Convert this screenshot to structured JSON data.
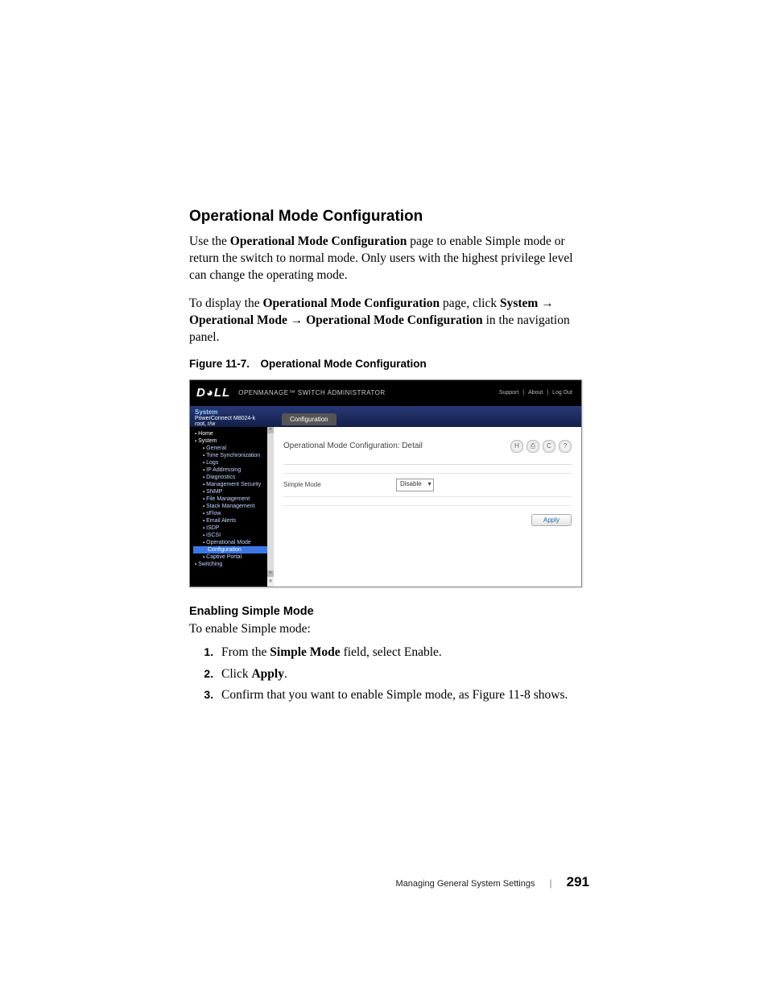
{
  "heading": "Operational Mode Configuration",
  "para1_a": "Use the ",
  "para1_b": "Operational Mode Configuration",
  "para1_c": " page to enable Simple mode or return the switch to normal mode. Only users with the highest privilege level can change the operating mode.",
  "para2_a": "To display the ",
  "para2_b": "Operational Mode Configuration",
  "para2_c": " page, click ",
  "para2_d": "System",
  "para2_e": " → ",
  "para2_f": "Operational Mode",
  "para2_g": " → ",
  "para2_h": "Operational Mode Configuration",
  "para2_i": " in the navigation panel.",
  "figcap": "Figure 11-7. Operational Mode Configuration",
  "screenshot": {
    "logo": "D◕LL",
    "subtitle": "OPENMANAGE™ SWITCH ADMINISTRATOR",
    "links": {
      "support": "Support",
      "about": "About",
      "logout": "Log Out"
    },
    "bar": {
      "system": "System",
      "device": "PowerConnect M8024-k",
      "user": "root, r/w"
    },
    "tab": "Configuration",
    "nav": {
      "home": "Home",
      "system": "System",
      "items": [
        "General",
        "Time Synchronization",
        "Logs",
        "IP Addressing",
        "Diagnostics",
        "Management Security",
        "SNMP",
        "File Management",
        "Stack Management",
        "sFlow",
        "Email Alerts",
        "ISDP",
        "iSCSI",
        "Operational Mode"
      ],
      "selected": "Configuration",
      "after": [
        "Captive Portal",
        "Switching"
      ]
    },
    "main": {
      "title": "Operational Mode Configuration: Detail",
      "field": "Simple Mode",
      "value": "Disable",
      "apply": "Apply"
    }
  },
  "h3": "Enabling Simple Mode",
  "intro2": "To enable Simple mode:",
  "steps": {
    "s1a": "From the ",
    "s1b": "Simple Mode",
    "s1c": " field, select Enable.",
    "s2a": "Click ",
    "s2b": "Apply",
    "s2c": ".",
    "s3": "Confirm that you want to enable Simple mode, as Figure 11-8 shows."
  },
  "footer": {
    "title": "Managing General System Settings",
    "page": "291"
  }
}
